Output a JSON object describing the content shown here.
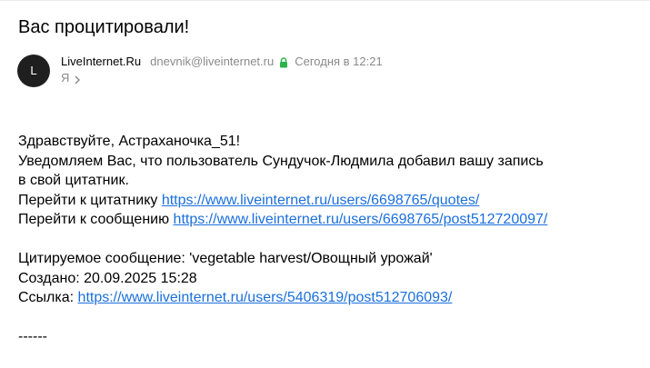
{
  "email": {
    "subject": "Вас процитировали!",
    "avatar_letter": "L",
    "sender_name": "LiveInternet.Ru",
    "sender_email": "dnevnik@liveinternet.ru",
    "date": "Сегодня в 12:21",
    "recipient": "Я",
    "icons": {
      "lock": "lock-icon",
      "chevron": "chevron-right-icon"
    },
    "colors": {
      "link": "#1a6fdc",
      "lock": "#2bb34d",
      "muted": "#8a8a8a"
    }
  },
  "body": {
    "greeting": "Здравствуйте, Астраханочка_51!",
    "notice_line1": "Уведомляем Вас, что пользователь Сундучок-Людмила добавил вашу запись",
    "notice_line2": "в свой цитатник.",
    "quotes_label": "Перейти к цитатнику",
    "quotes_url": "https://www.liveinternet.ru/users/6698765/quotes/",
    "post_label": "Перейти к сообщению",
    "post_url": "https://www.liveinternet.ru/users/6698765/post512720097/",
    "quoted_label": "Цитируемое сообщение: 'vegetable harvest/Овощный урожай'",
    "created_label": "Создано: 20.09.2025 15:28",
    "link_label": "Ссылка:",
    "link_url": "https://www.liveinternet.ru/users/5406319/post512706093/",
    "separator": "------"
  }
}
